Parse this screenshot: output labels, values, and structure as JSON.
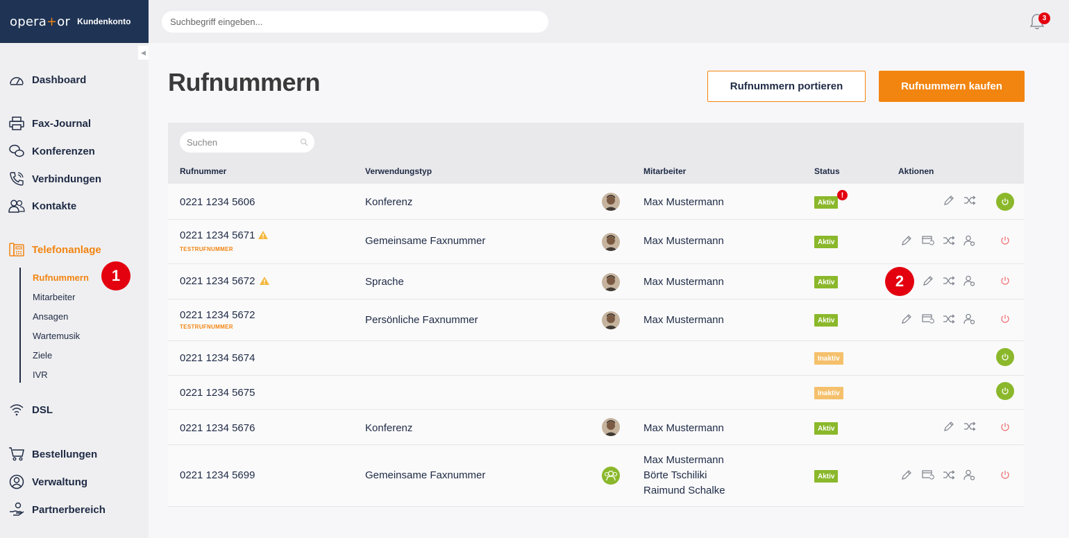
{
  "brand": {
    "logo_pre": "opera",
    "logo_plus": "+",
    "logo_post": "or",
    "subtitle": "Kundenkonto"
  },
  "topbar": {
    "search_placeholder": "Suchbegriff eingeben...",
    "notification_count": "3"
  },
  "sidebar": {
    "items": [
      {
        "label": "Dashboard",
        "icon": "speedometer-icon"
      },
      {
        "label": "Fax-Journal",
        "icon": "printer-icon"
      },
      {
        "label": "Konferenzen",
        "icon": "chat-bubbles-icon"
      },
      {
        "label": "Verbindungen",
        "icon": "phone-icon"
      },
      {
        "label": "Kontakte",
        "icon": "contacts-icon"
      },
      {
        "label": "Telefonanlage",
        "icon": "phone-system-icon"
      },
      {
        "label": "DSL",
        "icon": "wifi-icon"
      },
      {
        "label": "Bestellungen",
        "icon": "cart-icon"
      },
      {
        "label": "Verwaltung",
        "icon": "user-circle-icon"
      },
      {
        "label": "Partnerbereich",
        "icon": "partner-hand-icon"
      }
    ],
    "subitems": [
      "Rufnummern",
      "Mitarbeiter",
      "Ansagen",
      "Wartemusik",
      "Ziele",
      "IVR"
    ]
  },
  "annotations": {
    "marker1": "1",
    "marker2": "2"
  },
  "page": {
    "title": "Rufnummern",
    "btn_port": "Rufnummern portieren",
    "btn_buy": "Rufnummern kaufen"
  },
  "table": {
    "search_placeholder": "Suchen",
    "columns": [
      "Rufnummer",
      "Verwendungstyp",
      "Mitarbeiter",
      "Status",
      "Aktionen"
    ],
    "test_label": "TESTRUFNUMMER",
    "status_alert": "!",
    "rows": [
      {
        "number": "0221 1234 5606",
        "type": "Konferenz",
        "staff": "Max Mustermann",
        "status": "Aktiv"
      },
      {
        "number": "0221 1234 5671",
        "type": "Gemeinsame Faxnummer",
        "staff": "Max Mustermann",
        "status": "Aktiv"
      },
      {
        "number": "0221 1234 5672",
        "type": "Sprache",
        "staff": "Max Mustermann",
        "status": "Aktiv"
      },
      {
        "number": "0221 1234 5672",
        "type": "Persönliche Faxnummer",
        "staff": "Max Mustermann",
        "status": "Aktiv"
      },
      {
        "number": "0221 1234 5674",
        "type": "",
        "staff": "",
        "status": "Inaktiv"
      },
      {
        "number": "0221 1234 5675",
        "type": "",
        "staff": "",
        "status": "Inaktiv"
      },
      {
        "number": "0221 1234 5676",
        "type": "Konferenz",
        "staff": "Max Mustermann",
        "status": "Aktiv"
      },
      {
        "number": "0221 1234 5699",
        "type": "Gemeinsame Faxnummer",
        "staff_lines": [
          "Max Mustermann",
          "Börte Tschiliki",
          "Raimund Schalke"
        ],
        "status": "Aktiv"
      }
    ]
  },
  "colors": {
    "brand_navy": "#1f3454",
    "accent_orange": "#f28410",
    "status_green": "#8bb82b",
    "status_inactive": "#f5c06b",
    "alert_red": "#e3000f"
  }
}
